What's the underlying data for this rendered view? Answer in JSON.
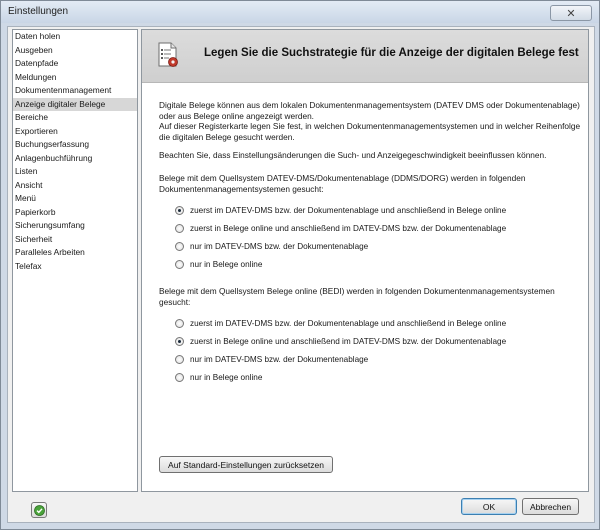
{
  "window": {
    "title": "Einstellungen",
    "close_glyph": "✕"
  },
  "sidebar": {
    "items": [
      {
        "label": "Daten holen"
      },
      {
        "label": "Ausgeben"
      },
      {
        "label": "Datenpfade"
      },
      {
        "label": "Meldungen"
      },
      {
        "label": "Dokumentenmanagement"
      },
      {
        "label": "Anzeige digitaler Belege",
        "selected": true
      },
      {
        "label": "Bereiche"
      },
      {
        "label": "Exportieren"
      },
      {
        "label": "Buchungserfassung"
      },
      {
        "label": "Anlagenbuchführung"
      },
      {
        "label": "Listen"
      },
      {
        "label": "Ansicht"
      },
      {
        "label": "Menü"
      },
      {
        "label": "Papierkorb"
      },
      {
        "label": "Sicherungsumfang"
      },
      {
        "label": "Sicherheit"
      },
      {
        "label": "Paralleles Arbeiten"
      },
      {
        "label": "Telefax"
      }
    ]
  },
  "content": {
    "header_title": "Legen Sie die Suchstrategie für die Anzeige der digitalen Belege fest",
    "header_icon": "document-settings-icon",
    "intro_lines": [
      "Digitale Belege können aus dem lokalen Dokumentenmanagementsystem (DATEV DMS oder Dokumentenablage)",
      "oder aus Belege online angezeigt werden.",
      "Auf dieser Registerkarte legen Sie fest, in welchen Dokumentenmanagementsystemen und in welcher Reihenfolge",
      "die digitalen Belege gesucht werden."
    ],
    "note": "Beachten Sie, dass Einstellungsänderungen die Such- und Anzeigegeschwindigkeit beeinflussen können.",
    "group1": {
      "lines": [
        "Belege mit dem Quellsystem DATEV-DMS/Dokumentenablage (DDMS/DORG) werden in folgenden",
        "Dokumentenmanagementsystemen gesucht:"
      ],
      "options": [
        {
          "label": "zuerst im DATEV-DMS bzw. der Dokumentenablage und anschließend in Belege online",
          "checked": true
        },
        {
          "label": "zuerst in Belege online und anschließend im DATEV-DMS bzw. der Dokumentenablage",
          "checked": false
        },
        {
          "label": "nur im DATEV-DMS bzw. der Dokumentenablage",
          "checked": false
        },
        {
          "label": "nur in Belege online",
          "checked": false
        }
      ]
    },
    "group2": {
      "lines": [
        "Belege mit dem Quellsystem Belege online (BEDI) werden in folgenden Dokumentenmanagementsystemen",
        "gesucht:"
      ],
      "options": [
        {
          "label": "zuerst im DATEV-DMS bzw. der Dokumentenablage und anschließend in Belege online",
          "checked": false
        },
        {
          "label": "zuerst in Belege online und anschließend im DATEV-DMS bzw. der Dokumentenablage",
          "checked": true
        },
        {
          "label": "nur im DATEV-DMS bzw. der Dokumentenablage",
          "checked": false
        },
        {
          "label": "nur in Belege online",
          "checked": false
        }
      ]
    },
    "reset_button": "Auf Standard-Einstellungen zurücksetzen"
  },
  "footer": {
    "ok": "OK",
    "cancel": "Abbrechen",
    "help_icon": "help-icon"
  },
  "colors": {
    "selected_item": "#d7d7d7",
    "header_bg": "#d4d4d4",
    "help_green": "#4aa33a"
  }
}
